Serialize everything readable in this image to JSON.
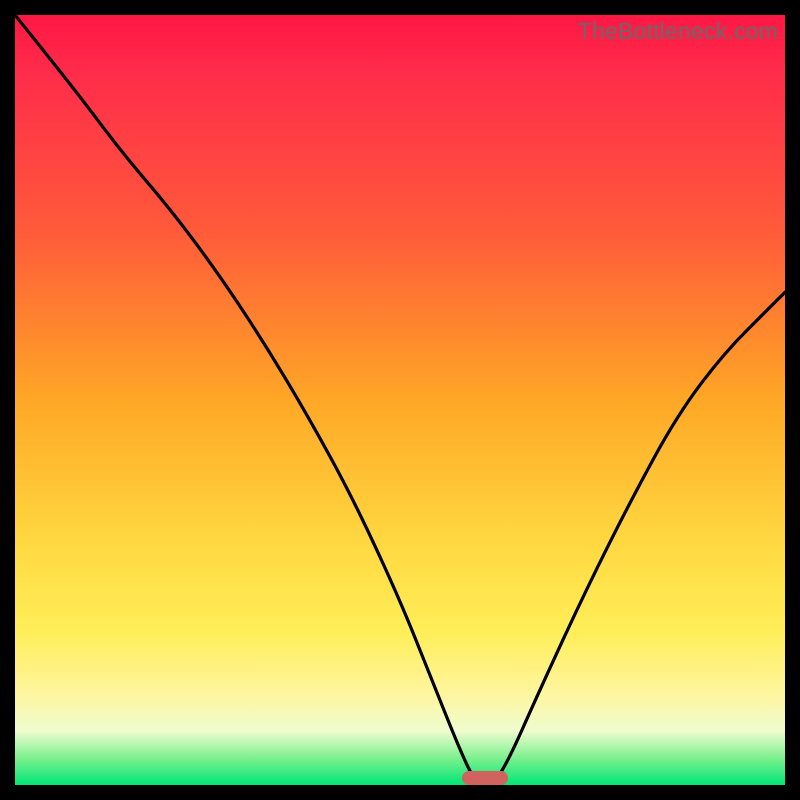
{
  "watermark": "TheBottleneck.com",
  "chart_data": {
    "type": "line",
    "title": "",
    "xlabel": "",
    "ylabel": "",
    "xlim": [
      0,
      100
    ],
    "ylim": [
      0,
      100
    ],
    "series": [
      {
        "name": "bottleneck-curve",
        "x": [
          0,
          8,
          14,
          20,
          26,
          32,
          38,
          44,
          50,
          54,
          58,
          60,
          62,
          64,
          68,
          74,
          80,
          86,
          92,
          98,
          100
        ],
        "values": [
          100,
          90,
          82,
          75,
          67,
          58,
          48,
          37,
          24,
          14,
          4,
          0,
          0,
          3,
          12,
          25,
          37,
          48,
          56,
          62,
          64
        ]
      }
    ],
    "minimum_marker": {
      "x_center": 61,
      "width": 6
    },
    "gradient_stops": [
      {
        "pct": 0,
        "color": "#ff1744"
      },
      {
        "pct": 28,
        "color": "#ff5a3a"
      },
      {
        "pct": 50,
        "color": "#ffa726"
      },
      {
        "pct": 80,
        "color": "#ffee58"
      },
      {
        "pct": 93,
        "color": "#eefccf"
      },
      {
        "pct": 100,
        "color": "#00e676"
      }
    ]
  }
}
